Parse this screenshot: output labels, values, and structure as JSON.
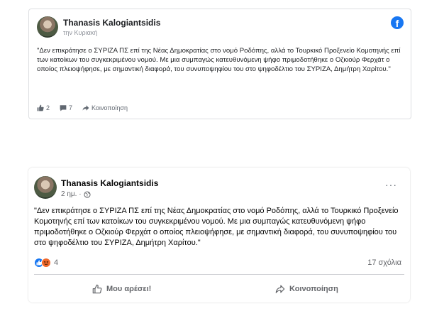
{
  "post_embed": {
    "author": "Thanasis Kalogiantsidis",
    "time": "την Κυριακή",
    "text": "\"Δεν επικράτησε ο ΣΥΡΙΖΑ ΠΣ επί της Νέας Δημοκρατίας στο νομό Ροδόπης, αλλά το Τουρκικό Προξενείο Κομοτηνής επί των κατοίκων του συγκεκριμένου νομού. Με μια συμπαγώς κατευθυνόμενη ψήφο πριμοδοτήθηκε ο Οζκιούρ Φερχάτ ο οποίος πλειοψήφησε, με σημαντική διαφορά, του συνυποψηφίου του στο ψηφοδέλτιο του ΣΥΡΙΖΑ, Δημήτρη Χαρίτου.\"",
    "likes": "2",
    "comments": "7",
    "share_label": "Κοινοποίηση",
    "logo_letter": "f",
    "brand_color": "#1877f2",
    "icons": [
      "thumbs-up-icon",
      "comment-icon",
      "share-icon",
      "facebook-logo"
    ]
  },
  "post_native": {
    "author": "Thanasis Kalogiantsidis",
    "time": "2 ημ. ·",
    "text": "\"Δεν επικράτησε ο ΣΥΡΙΖΑ ΠΣ επί της Νέας Δημοκρατίας στο νομό Ροδόπης, αλλά το Τουρκικό Προξενείο Κομοτηνής επί των κατοίκων του συγκεκριμένου νομού. Με μια συμπαγώς κατευθυνόμενη ψήφο πριμοδοτήθηκε ο Οζκιούρ Φερχάτ ο οποίος πλειοψήφησε, με σημαντική διαφορά, του συνυποψηφίου του στο ψηφοδέλτιο του ΣΥΡΙΖΑ, Δημήτρη Χαρίτου.\"",
    "reactions_count": "4",
    "comments_label": "17 σχόλια",
    "like_label": "Μου αρέσει!",
    "share_label": "Κοινοποίηση",
    "more_label": "···",
    "icons": [
      "globe-icon",
      "like-reaction-icon",
      "angry-reaction-icon",
      "thumbs-up-icon",
      "share-icon",
      "more-icon"
    ]
  }
}
